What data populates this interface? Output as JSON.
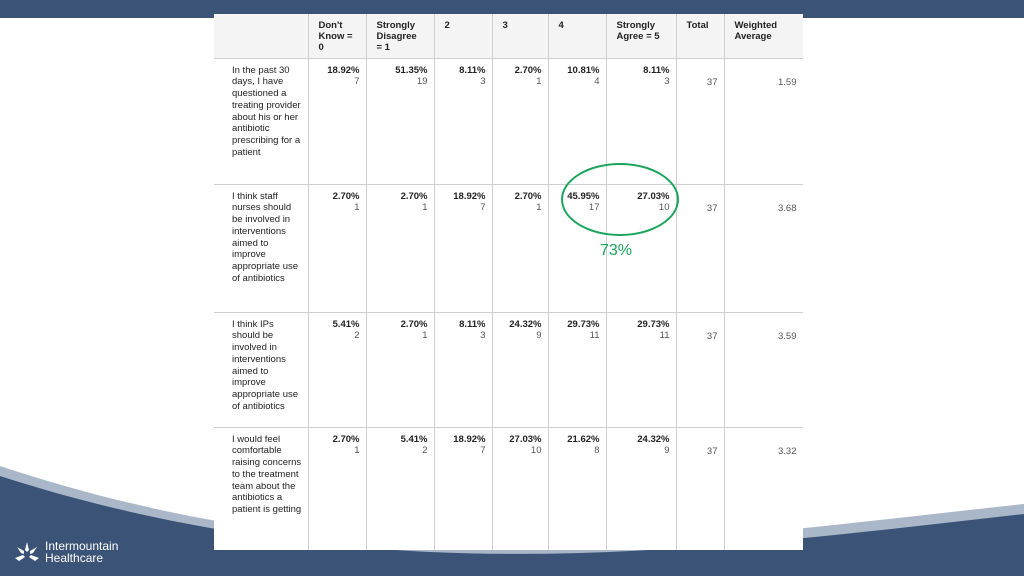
{
  "headers": [
    "",
    "Don't Know = 0",
    "Strongly Disagree = 1",
    "2",
    "3",
    "4",
    "Strongly Agree = 5",
    "Total",
    "Weighted Average"
  ],
  "rows": [
    {
      "question": "In the past 30 days, I have questioned a treating provider about his or her antibiotic prescribing for a patient",
      "cells": [
        {
          "pct": "18.92%",
          "count": "7"
        },
        {
          "pct": "51.35%",
          "count": "19"
        },
        {
          "pct": "8.11%",
          "count": "3"
        },
        {
          "pct": "2.70%",
          "count": "1"
        },
        {
          "pct": "10.81%",
          "count": "4"
        },
        {
          "pct": "8.11%",
          "count": "3"
        }
      ],
      "total": "37",
      "weighted_average": "1.59"
    },
    {
      "question": "I think staff nurses should be involved in interventions aimed to improve appropriate use of antibiotics",
      "cells": [
        {
          "pct": "2.70%",
          "count": "1"
        },
        {
          "pct": "2.70%",
          "count": "1"
        },
        {
          "pct": "18.92%",
          "count": "7"
        },
        {
          "pct": "2.70%",
          "count": "1"
        },
        {
          "pct": "45.95%",
          "count": "17"
        },
        {
          "pct": "27.03%",
          "count": "10"
        }
      ],
      "total": "37",
      "weighted_average": "3.68"
    },
    {
      "question": "I think IPs should be involved in interventions aimed to improve appropriate use of antibiotics",
      "cells": [
        {
          "pct": "5.41%",
          "count": "2"
        },
        {
          "pct": "2.70%",
          "count": "1"
        },
        {
          "pct": "8.11%",
          "count": "3"
        },
        {
          "pct": "24.32%",
          "count": "9"
        },
        {
          "pct": "29.73%",
          "count": "11"
        },
        {
          "pct": "29.73%",
          "count": "11"
        }
      ],
      "total": "37",
      "weighted_average": "3.59"
    },
    {
      "question": "I would feel comfortable raising concerns to the treatment team about the antibiotics a patient is getting",
      "cells": [
        {
          "pct": "2.70%",
          "count": "1"
        },
        {
          "pct": "5.41%",
          "count": "2"
        },
        {
          "pct": "18.92%",
          "count": "7"
        },
        {
          "pct": "27.03%",
          "count": "10"
        },
        {
          "pct": "21.62%",
          "count": "8"
        },
        {
          "pct": "24.32%",
          "count": "9"
        }
      ],
      "total": "37",
      "weighted_average": "3.32"
    }
  ],
  "annotation": "73%",
  "logo": {
    "line1": "Intermountain",
    "line2": "Healthcare"
  },
  "colors": {
    "band": "#3a5377",
    "highlight": "#1aa55a",
    "wave_light": "#a9b7c9"
  }
}
